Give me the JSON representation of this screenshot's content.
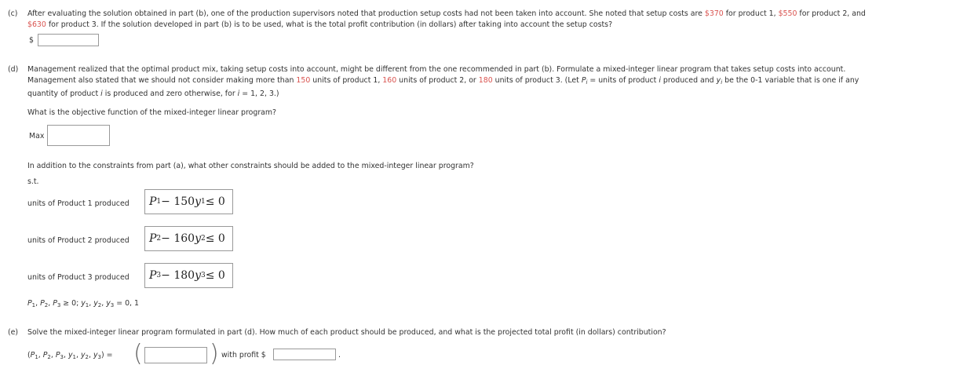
{
  "part_c": {
    "label": "(c)",
    "line1_pre": "After evaluating the solution obtained in part (b), one of the production supervisors noted that production setup costs had not been taken into account. She noted that setup costs are ",
    "cost1": "$370",
    "line1_mid1": " for product 1, ",
    "cost2": "$550",
    "line1_mid2": " for product 2, and",
    "cost3": "$630",
    "line2_rest": " for product 3. If the solution developed in part (b) is to be used, what is the total profit contribution (in dollars) after taking into account the setup costs?",
    "dollar": "$",
    "answer_value": ""
  },
  "part_d": {
    "label": "(d)",
    "line1": "Management realized that the optimal product mix, taking setup costs into account, might be different from the one recommended in part (b). Formulate a mixed-integer linear program that takes setup costs into account.",
    "line2_pre": "Management also stated that we should not consider making more than ",
    "limit1": "150",
    "line2_mid1": " units of product 1, ",
    "limit2": "160",
    "line2_mid2": " units of product 2, or ",
    "limit3": "180",
    "line2_mid3": " units of product 3. (Let ",
    "line2_P": "P",
    "line2_i": "i",
    "line2_eq": " = units of product ",
    "line2_i2": "i",
    "line2_produced": " produced and ",
    "line2_y": "y",
    "line2_i3": "i",
    "line2_end": " be the 0-1 variable that is one if any",
    "line3_pre": "quantity of product ",
    "line3_i": "i",
    "line3_mid": " is produced and zero otherwise, for ",
    "line3_i2": "i",
    "line3_end": " = 1, 2, 3.)",
    "question_objective": "What is the objective function of the mixed-integer linear program?",
    "max_label": "Max",
    "objective_value": "",
    "question_constraints": "In addition to the constraints from part (a), what other constraints should be added to the mixed-integer linear program?",
    "st_label": "s.t.",
    "constraints": [
      {
        "label": "units of Product 1 produced",
        "P": "P",
        "sub": "1",
        "expr": " − 150",
        "y": "y",
        "ysub": "1",
        "rel": " ≤ 0"
      },
      {
        "label": "units of Product 2 produced",
        "P": "P",
        "sub": "2",
        "expr": " − 160",
        "y": "y",
        "ysub": "2",
        "rel": " ≤ 0"
      },
      {
        "label": "units of Product 3 produced",
        "P": "P",
        "sub": "3",
        "expr": " − 180",
        "y": "y",
        "ysub": "3",
        "rel": " ≤ 0"
      }
    ],
    "nonneg": {
      "P": "P",
      "s1": "1",
      "c1": ", ",
      "s2": "2",
      "c2": ", ",
      "s3": "3",
      "mid": " ≥ 0; ",
      "y": "y",
      "ys1": "1",
      "yc1": ", ",
      "ys2": "2",
      "yc2": ", ",
      "ys3": "3",
      "end": " = 0, 1"
    }
  },
  "part_e": {
    "label": "(e)",
    "question": "Solve the mixed-integer linear program formulated in part (d). How much of each product should be produced, and what is the projected total profit (in dollars) contribution?",
    "tuple": {
      "open": "(",
      "P": "P",
      "s1": "1",
      "c1": ", ",
      "s2": "2",
      "c2": ", ",
      "s3": "3",
      "c3": ", ",
      "y": "y",
      "ys1": "1",
      "yc1": ", ",
      "ys2": "2",
      "yc2": ", ",
      "ys3": "3",
      "close": ") ="
    },
    "big_open_paren": "(",
    "big_close_paren": ")",
    "solution_value": "",
    "with_profit": "with profit $",
    "profit_value": "",
    "period": "."
  }
}
